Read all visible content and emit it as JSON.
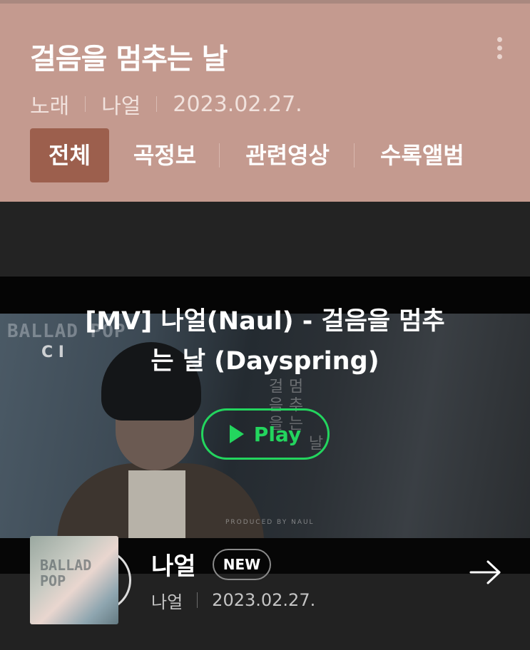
{
  "header": {
    "title": "걸음을 멈추는 날",
    "more_icon": "more-vertical-icon",
    "meta": {
      "type": "노래",
      "artist": "나얼",
      "date": "2023.02.27."
    },
    "tabs": [
      {
        "label": "전체",
        "active": true
      },
      {
        "label": "곡정보",
        "active": false
      },
      {
        "label": "관련영상",
        "active": false
      },
      {
        "label": "수록앨범",
        "active": false
      }
    ],
    "colors": {
      "background": "#c49a8f",
      "active_tab": "#9c5f4d"
    }
  },
  "video": {
    "title": "[MV] 나얼(Naul) - 걸음을 멈추는 날 (Dayspring)",
    "play_label": "Play",
    "play_color": "#23d55e",
    "artwork_text": {
      "ballad_pop": "BALLAD POP",
      "ci": "C I",
      "vertical_1": "걸음을",
      "vertical_2": "멈추는",
      "vertical_3": "날",
      "produced_by": "PRODUCED BY NAUL"
    }
  },
  "artist_card": {
    "name": "나얼",
    "badge": "NEW",
    "sub_artist": "나얼",
    "date": "2023.02.27.",
    "arrow_icon": "arrow-right-icon"
  }
}
